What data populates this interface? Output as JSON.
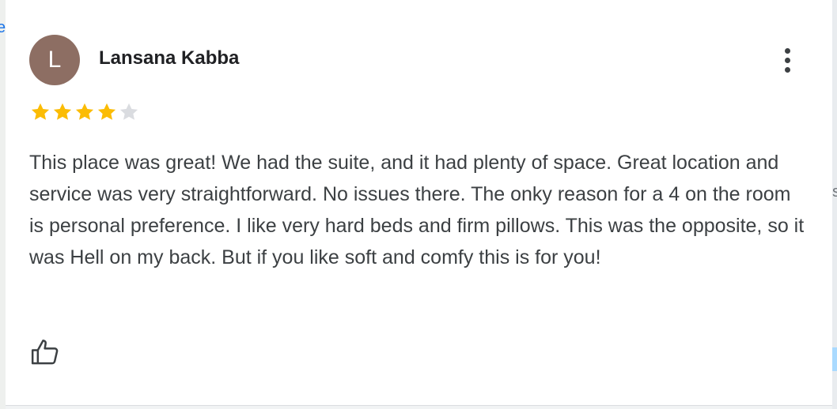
{
  "map_edge": {
    "left_letter": "e",
    "right_letter": "s"
  },
  "review": {
    "avatar_initial": "L",
    "avatar_color": "#8d6e63",
    "reviewer_name": "Lansana Kabba",
    "rating": 4,
    "max_rating": 5,
    "star_color_filled": "#fbbc04",
    "star_color_empty": "#dadce0",
    "text": "This place was great! We had the suite, and it had plenty of space. Great location and service was very straightforward. No issues there. The onky reason for a 4 on the room is personal preference. I like very hard beds and firm pillows. This was the opposite, so it was Hell on my back. But if you like soft and comfy this is for you!"
  },
  "icons": {
    "more": "more-vertical-icon",
    "like": "thumbs-up-icon",
    "star": "star-icon"
  }
}
